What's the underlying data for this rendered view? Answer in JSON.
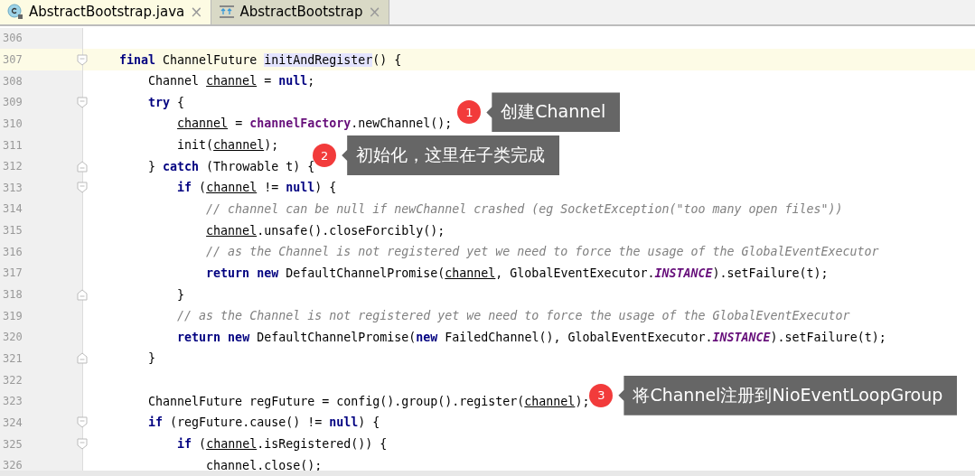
{
  "tabs": [
    {
      "label": "AbstractBootstrap.java",
      "selected": true
    },
    {
      "label": "AbstractBootstrap",
      "selected": false
    }
  ],
  "close_glyph": "×",
  "lines": [
    {
      "number": "306",
      "current": false,
      "fold_start": false,
      "fold_end": false
    },
    {
      "number": "307",
      "current": true,
      "fold_start": true,
      "fold_end": false,
      "tokens": [
        {
          "t": "    final",
          "kind": "kw"
        },
        {
          "t": " ChannelFuture "
        },
        {
          "t": "initAndRegister",
          "kind": "hl"
        },
        {
          "t": "() {"
        }
      ]
    },
    {
      "number": "308",
      "current": false,
      "fold_start": false,
      "fold_end": false,
      "tokens": [
        {
          "t": "        Channel "
        },
        {
          "t": "channel",
          "kind": "var"
        },
        {
          "t": " = "
        },
        {
          "t": "null",
          "kind": "kw"
        },
        {
          "t": ";"
        }
      ]
    },
    {
      "number": "309",
      "current": false,
      "fold_start": true,
      "fold_end": false,
      "tokens": [
        {
          "t": "        try",
          "kind": "kw"
        },
        {
          "t": " {"
        }
      ]
    },
    {
      "number": "310",
      "current": false,
      "fold_start": false,
      "fold_end": false,
      "tokens": [
        {
          "t": "            channel",
          "kind": "var"
        },
        {
          "t": " = "
        },
        {
          "t": "channelFactory",
          "kind": "field"
        },
        {
          "t": ".newChannel();"
        }
      ],
      "callout": {
        "badge": "1",
        "text": "创建Channel",
        "kind": "above"
      }
    },
    {
      "number": "311",
      "current": false,
      "fold_start": false,
      "fold_end": false,
      "tokens": [
        {
          "t": "            init("
        },
        {
          "t": "channel",
          "kind": "var"
        },
        {
          "t": ");"
        }
      ],
      "callout": {
        "badge": "2",
        "text": "初始化，这里在子类完成",
        "kind": "below"
      }
    },
    {
      "number": "312",
      "current": false,
      "fold_start": false,
      "fold_end": true,
      "tokens": [
        {
          "t": "        } "
        },
        {
          "t": "catch",
          "kind": "kw"
        },
        {
          "t": " (Throwable t) {"
        }
      ]
    },
    {
      "number": "313",
      "current": false,
      "fold_start": true,
      "fold_end": false,
      "tokens": [
        {
          "t": "            if",
          "kind": "kw"
        },
        {
          "t": " ("
        },
        {
          "t": "channel",
          "kind": "var"
        },
        {
          "t": " != "
        },
        {
          "t": "null",
          "kind": "kw"
        },
        {
          "t": ") {"
        }
      ]
    },
    {
      "number": "314",
      "current": false,
      "fold_start": false,
      "fold_end": false,
      "tokens": [
        {
          "t": "                // channel can be null if newChannel crashed (eg SocketException(\"too many open files\"))",
          "kind": "comment"
        }
      ]
    },
    {
      "number": "315",
      "current": false,
      "fold_start": false,
      "fold_end": false,
      "tokens": [
        {
          "t": "                channel",
          "kind": "var"
        },
        {
          "t": ".unsafe().closeForcibly();"
        }
      ]
    },
    {
      "number": "316",
      "current": false,
      "fold_start": false,
      "fold_end": false,
      "tokens": [
        {
          "t": "                // as the Channel is not registered yet we need to force the usage of the GlobalEventExecutor",
          "kind": "comment"
        }
      ]
    },
    {
      "number": "317",
      "current": false,
      "fold_start": false,
      "fold_end": false,
      "tokens": [
        {
          "t": "                return new",
          "kind": "kw"
        },
        {
          "t": " DefaultChannelPromise("
        },
        {
          "t": "channel",
          "kind": "var"
        },
        {
          "t": ", GlobalEventExecutor."
        },
        {
          "t": "INSTANCE",
          "kind": "static"
        },
        {
          "t": ").setFailure(t);"
        }
      ]
    },
    {
      "number": "318",
      "current": false,
      "fold_start": false,
      "fold_end": true,
      "tokens": [
        {
          "t": "            }"
        }
      ]
    },
    {
      "number": "319",
      "current": false,
      "fold_start": false,
      "fold_end": false,
      "tokens": [
        {
          "t": "            // as the Channel is not registered yet we need to force the usage of the GlobalEventExecutor",
          "kind": "comment"
        }
      ]
    },
    {
      "number": "320",
      "current": false,
      "fold_start": false,
      "fold_end": false,
      "tokens": [
        {
          "t": "            return new",
          "kind": "kw"
        },
        {
          "t": " DefaultChannelPromise("
        },
        {
          "t": "new",
          "kind": "kw"
        },
        {
          "t": " FailedChannel(), GlobalEventExecutor."
        },
        {
          "t": "INSTANCE",
          "kind": "static"
        },
        {
          "t": ").setFailure(t);"
        }
      ]
    },
    {
      "number": "321",
      "current": false,
      "fold_start": false,
      "fold_end": true,
      "tokens": [
        {
          "t": "        }"
        }
      ]
    },
    {
      "number": "322",
      "current": false,
      "fold_start": false,
      "fold_end": false
    },
    {
      "number": "323",
      "current": false,
      "fold_start": false,
      "fold_end": false,
      "tokens": [
        {
          "t": "        ChannelFuture regFuture = config().group().register("
        },
        {
          "t": "channel",
          "kind": "var"
        },
        {
          "t": ");"
        }
      ],
      "callout": {
        "badge": "3",
        "text": "将Channel注册到NioEventLoopGroup",
        "kind": "level"
      }
    },
    {
      "number": "324",
      "current": false,
      "fold_start": true,
      "fold_end": false,
      "tokens": [
        {
          "t": "        if",
          "kind": "kw"
        },
        {
          "t": " (regFuture.cause() != "
        },
        {
          "t": "null",
          "kind": "kw"
        },
        {
          "t": ") {"
        }
      ]
    },
    {
      "number": "325",
      "current": false,
      "fold_start": true,
      "fold_end": false,
      "tokens": [
        {
          "t": "            if",
          "kind": "kw"
        },
        {
          "t": " ("
        },
        {
          "t": "channel",
          "kind": "var"
        },
        {
          "t": ".isRegistered()) {"
        }
      ]
    },
    {
      "number": "326",
      "current": false,
      "fold_start": false,
      "fold_end": false,
      "tokens": [
        {
          "t": "                channel",
          "kind": "var"
        },
        {
          "t": ".close();"
        }
      ]
    }
  ]
}
